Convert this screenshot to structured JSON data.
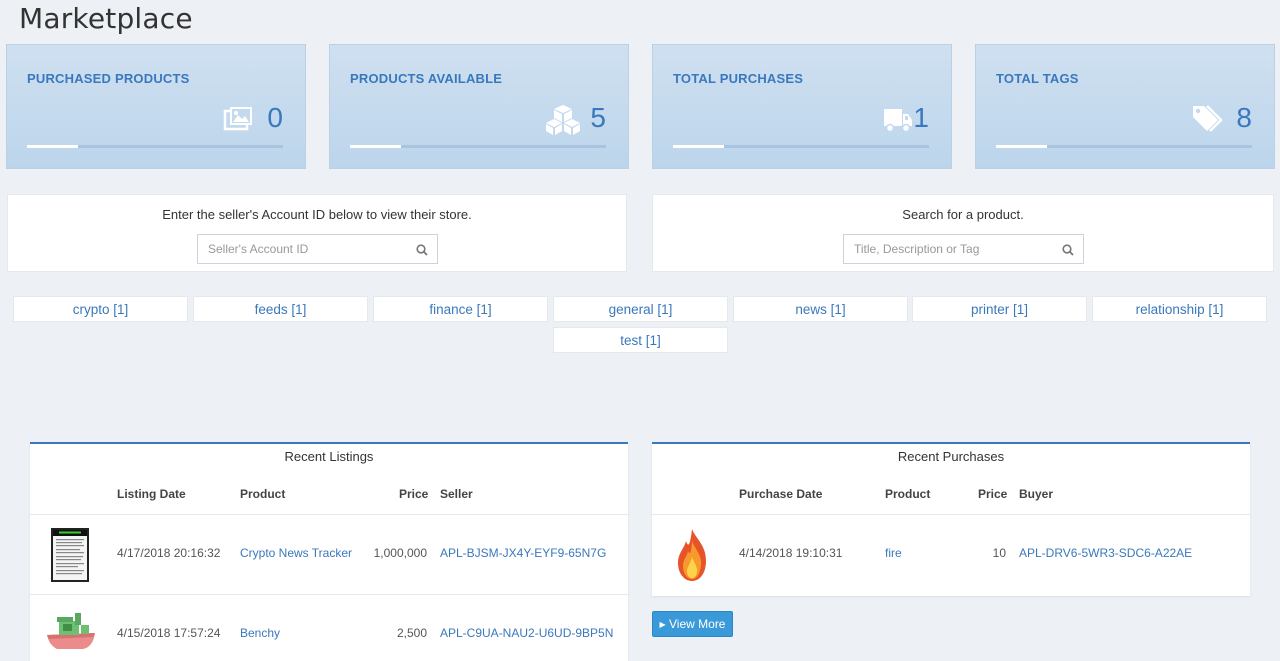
{
  "page": {
    "title": "Marketplace"
  },
  "stats": [
    {
      "label": "PURCHASED PRODUCTS",
      "value": "0",
      "icon": "images-icon"
    },
    {
      "label": "PRODUCTS AVAILABLE",
      "value": "5",
      "icon": "cubes-icon"
    },
    {
      "label": "TOTAL PURCHASES",
      "value": "1",
      "icon": "truck-icon"
    },
    {
      "label": "TOTAL TAGS",
      "value": "8",
      "icon": "tags-icon"
    }
  ],
  "seller_search": {
    "prompt": "Enter the seller's Account ID below to view their store.",
    "placeholder": "Seller's Account ID"
  },
  "product_search": {
    "prompt": "Search for a product.",
    "placeholder": "Title, Description or Tag"
  },
  "tags": [
    "crypto [1]",
    "feeds [1]",
    "finance [1]",
    "general [1]",
    "news [1]",
    "printer [1]",
    "relationship [1]",
    "test [1]"
  ],
  "recent_listings": {
    "title": "Recent Listings",
    "headers": {
      "date": "Listing Date",
      "product": "Product",
      "price": "Price",
      "seller": "Seller"
    },
    "rows": [
      {
        "date": "4/17/2018 20:16:32",
        "product": "Crypto News Tracker",
        "price": "1,000,000",
        "seller": "APL-BJSM-JX4Y-EYF9-65N7G"
      },
      {
        "date": "4/15/2018 17:57:24",
        "product": "Benchy",
        "price": "2,500",
        "seller": "APL-C9UA-NAU2-U6UD-9BP5N"
      }
    ]
  },
  "recent_purchases": {
    "title": "Recent Purchases",
    "headers": {
      "date": "Purchase Date",
      "product": "Product",
      "price": "Price",
      "buyer": "Buyer"
    },
    "rows": [
      {
        "date": "4/14/2018 19:10:31",
        "product": "fire",
        "price": "10",
        "buyer": "APL-DRV6-5WR3-SDC6-A22AE"
      }
    ]
  },
  "view_more": {
    "label": "View More"
  },
  "colors": {
    "accent": "#3a78bd",
    "button": "#3a9ad9",
    "card_bg": "#c8dcef"
  }
}
